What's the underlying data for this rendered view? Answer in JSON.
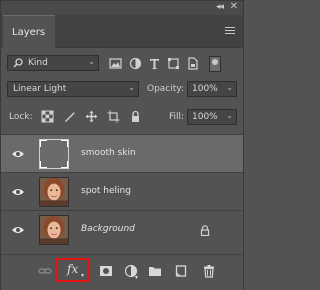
{
  "panel": {
    "collapse_glyph": "◂◂",
    "close_glyph": "✕",
    "tab_label": "Layers"
  },
  "filter": {
    "label": "Kind",
    "icons": [
      "image-filter-icon",
      "adjustment-filter-icon",
      "type-filter-icon",
      "shape-filter-icon",
      "smart-object-filter-icon",
      "filter-toggle-icon"
    ]
  },
  "blend": {
    "mode": "Linear Light",
    "opacity_label": "Opacity:",
    "opacity_value": "100%"
  },
  "lock": {
    "label": "Lock:",
    "fill_label": "Fill:",
    "fill_value": "100%"
  },
  "layers": [
    {
      "name": "smooth skin",
      "selected": true,
      "visible": true,
      "thumb": "gray-fill"
    },
    {
      "name": "spot heling",
      "selected": false,
      "visible": true,
      "thumb": "portrait"
    },
    {
      "name": "Background",
      "selected": false,
      "visible": true,
      "thumb": "portrait",
      "locked": true,
      "italic": true
    }
  ],
  "toolbar": {
    "fx_label": "fx"
  },
  "colors": {
    "highlight": "#e11414",
    "panel_bg": "#535353",
    "selected_row": "#6a6a6a"
  }
}
